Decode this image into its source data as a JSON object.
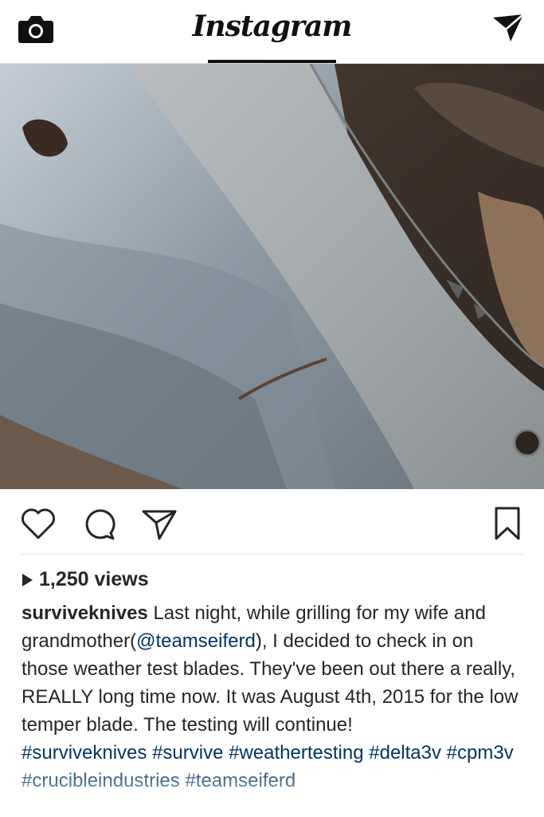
{
  "header": {
    "title": "Instagram",
    "camera_icon": "camera-icon",
    "direct_icon": "direct-message-icon"
  },
  "post": {
    "image_alt": "Knife blade on stone and leaves",
    "actions": {
      "like_icon": "heart-icon",
      "comment_icon": "comment-icon",
      "share_icon": "share-icon",
      "save_icon": "bookmark-icon"
    },
    "views": "1,250 views",
    "username": "surviveknives",
    "caption_part1": " Last night, while grilling for my wife and grandmother(",
    "mention": "@teamseiferd",
    "caption_part2": "), I decided to check in on those weather test blades. They've been out there a really, REALLY long time now. It was August 4th, 2015 for the low temper blade. The testing will continue!",
    "hashtags": [
      "#surviveknives",
      "#survive",
      "#weathertesting",
      "#delta3v",
      "#cpm3v",
      "#crucibleindustries",
      "#teamseiferd"
    ]
  },
  "colors": {
    "link": "#003569",
    "text": "#262626",
    "divider": "#dbdbdb"
  }
}
